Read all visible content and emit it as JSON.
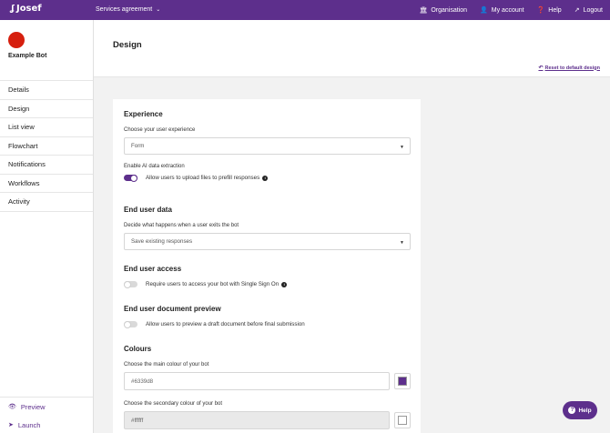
{
  "topbar": {
    "logo_text": "Josef",
    "agreement_label": "Services agreement",
    "nav": [
      {
        "label": "Organisation",
        "icon": "building-icon"
      },
      {
        "label": "My account",
        "icon": "user-icon"
      },
      {
        "label": "Help",
        "icon": "question-icon"
      },
      {
        "label": "Logout",
        "icon": "logout-icon"
      }
    ],
    "brand_color": "#5d2f8c"
  },
  "sidebar": {
    "bot_name": "Example Bot",
    "avatar_color": "#d61f0e",
    "items": [
      {
        "label": "Details"
      },
      {
        "label": "Design"
      },
      {
        "label": "List view"
      },
      {
        "label": "Flowchart"
      },
      {
        "label": "Notifications"
      },
      {
        "label": "Workflows"
      },
      {
        "label": "Activity"
      }
    ],
    "bottom_items": [
      {
        "label": "Preview",
        "icon": "eye-icon"
      },
      {
        "label": "Launch",
        "icon": "rocket-icon"
      }
    ]
  },
  "header": {
    "title": "Design",
    "reset_label": "Reset to default design"
  },
  "form": {
    "experience": {
      "title": "Experience",
      "choose_label": "Choose your user experience",
      "choose_value": "Form",
      "ai_label": "Enable AI data extraction",
      "ai_toggle_label": "Allow users to upload files to prefill responses",
      "ai_toggle_on": true
    },
    "end_user_data": {
      "title": "End user data",
      "exit_label": "Decide what happens when a user exits the bot",
      "exit_value": "Save existing responses"
    },
    "end_user_access": {
      "title": "End user access",
      "sso_label": "Require users to access your bot with Single Sign On",
      "sso_on": false
    },
    "doc_preview": {
      "title": "End user document preview",
      "preview_label": "Allow users to preview a draft document before final submission",
      "preview_on": false
    },
    "colours": {
      "title": "Colours",
      "main_label": "Choose the main colour of your bot",
      "main_value": "#6339d8",
      "secondary_label": "Choose the secondary colour of your bot",
      "secondary_value": "#ffffff"
    }
  },
  "help_fab": {
    "label": "Help"
  }
}
